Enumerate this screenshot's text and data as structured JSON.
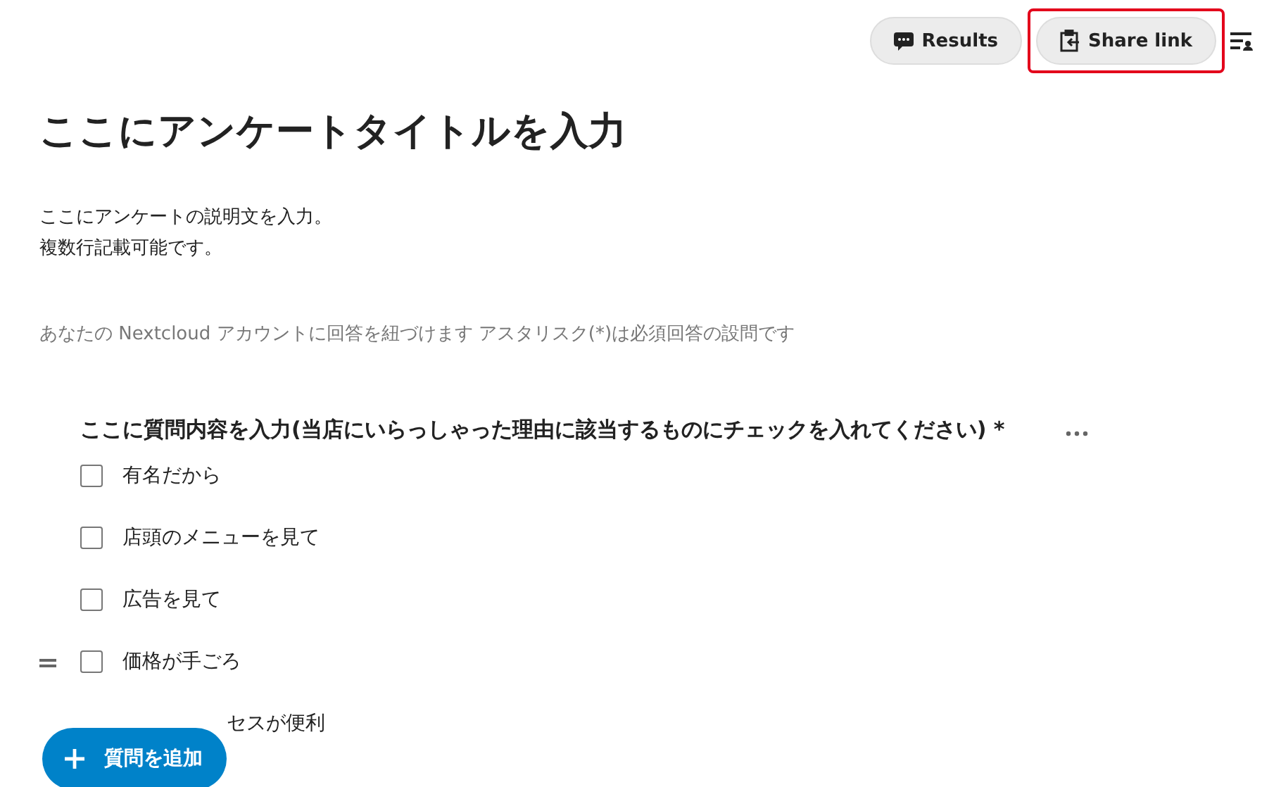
{
  "header": {
    "buttons": [
      {
        "label": "Results",
        "kind": "results",
        "highlighted": false
      },
      {
        "label": "Share link",
        "kind": "share",
        "highlighted": true
      }
    ]
  },
  "title": "ここにアンケートタイトルを入力",
  "description": [
    "ここにアンケートの説明文を入力。",
    "複数行記載可能です。"
  ],
  "note": "あなたの Nextcloud アカウントに回答を紐づけます アスタリスク(*)は必須回答の設問です",
  "question": {
    "title": "ここに質問内容を入力(当店にいらっしゃった理由に該当するものにチェックを入れてください) *",
    "options": [
      {
        "kind": "checkbox",
        "label": "有名だから",
        "checked": false,
        "hovered": false
      },
      {
        "kind": "checkbox",
        "label": "店頭のメニューを見て",
        "checked": false,
        "hovered": false
      },
      {
        "kind": "checkbox",
        "label": "広告を見て",
        "checked": false,
        "hovered": false
      },
      {
        "kind": "checkbox",
        "label": "価格が手ごろ",
        "checked": false,
        "hovered": true
      },
      {
        "kind": "covered",
        "label": "セスが便利"
      }
    ]
  },
  "add_button": {
    "label": "質問を追加"
  }
}
